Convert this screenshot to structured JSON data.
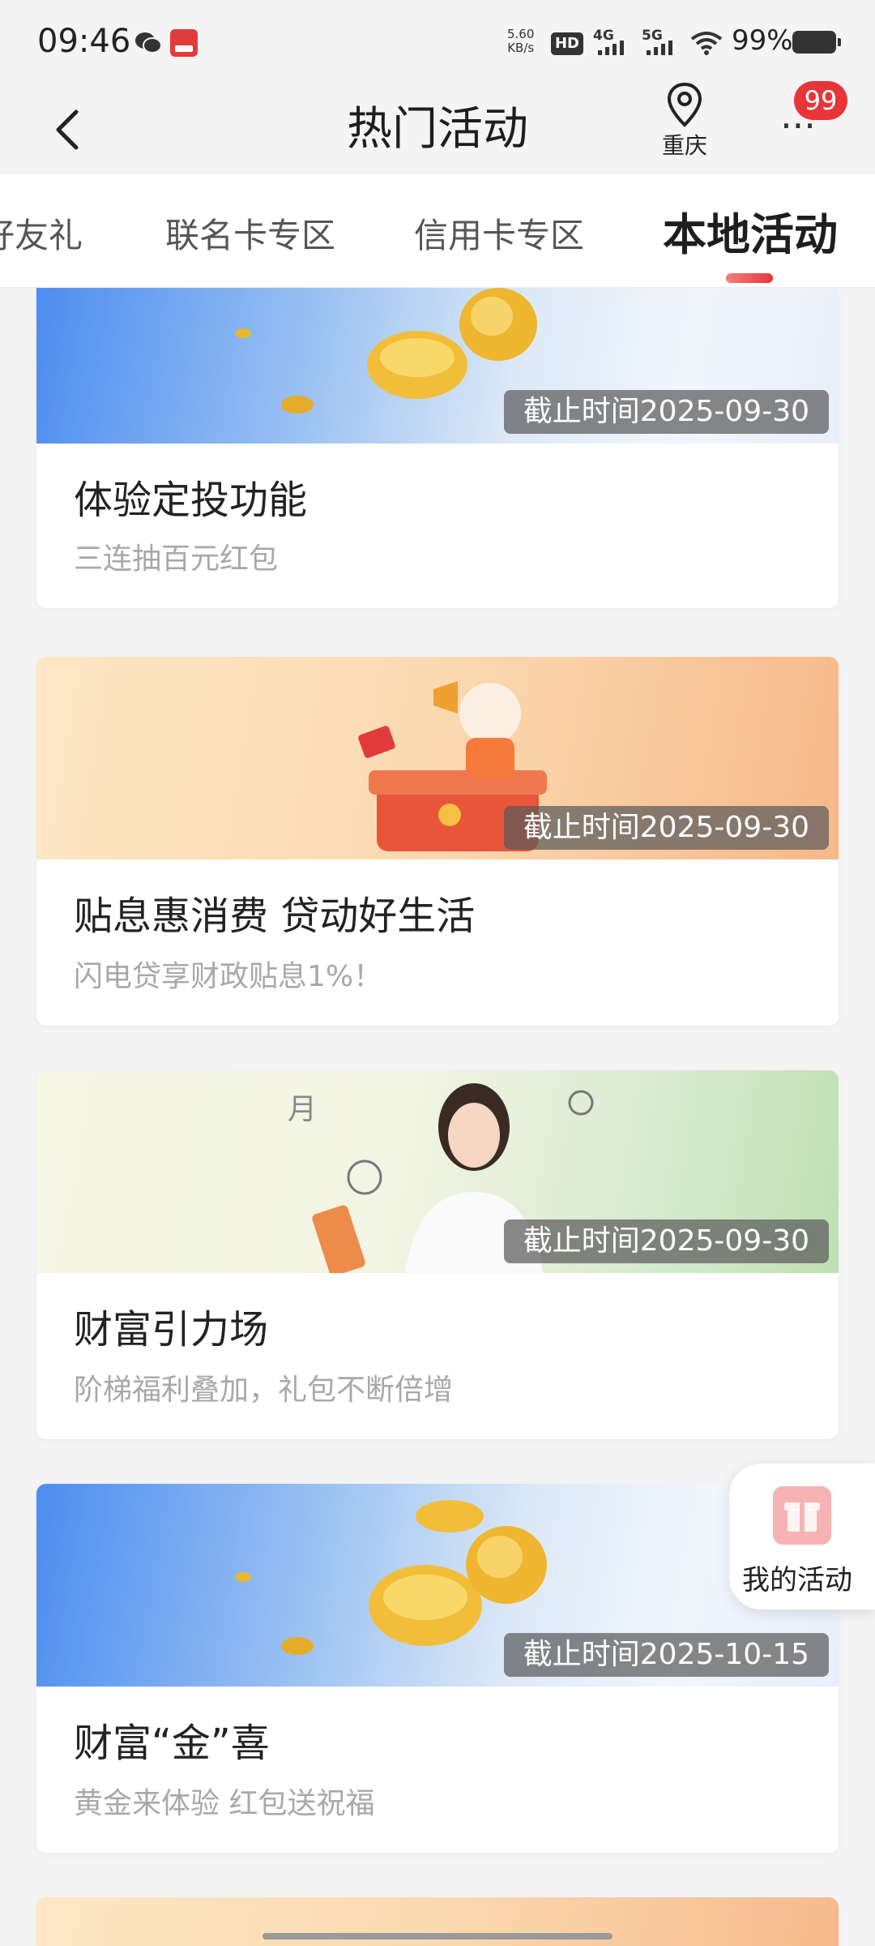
{
  "status_bar": {
    "time": "09:46",
    "net_speed_value": "5.60",
    "net_speed_unit": "KB/s",
    "hd_label": "HD",
    "sig1_label": "4G",
    "sig2_label": "5G",
    "battery": "99%"
  },
  "header": {
    "title": "热门活动",
    "location": "重庆",
    "more_label": "...",
    "badge_count": "99"
  },
  "tabs": [
    {
      "label": "好友礼"
    },
    {
      "label": "联名卡专区"
    },
    {
      "label": "信用卡专区"
    },
    {
      "label": "本地活动",
      "active": true
    }
  ],
  "cards": [
    {
      "title": "体验定投功能",
      "subtitle": "三连抽百元红包",
      "deadline": "截止时间2025-09-30"
    },
    {
      "title": "贴息惠消费 贷动好生活",
      "subtitle": "闪电贷享财政贴息1%！",
      "deadline": "截止时间2025-09-30"
    },
    {
      "title": "财富引力场",
      "subtitle": "阶梯福利叠加，礼包不断倍增",
      "deadline": "截止时间2025-09-30"
    },
    {
      "title": "财富“金”喜",
      "subtitle": "黄金来体验 红包送祝福",
      "deadline": "截止时间2025-10-15"
    }
  ],
  "floating": {
    "label": "我的活动"
  },
  "colors": {
    "accent": "#e8353a",
    "badge": "#e8353a"
  }
}
